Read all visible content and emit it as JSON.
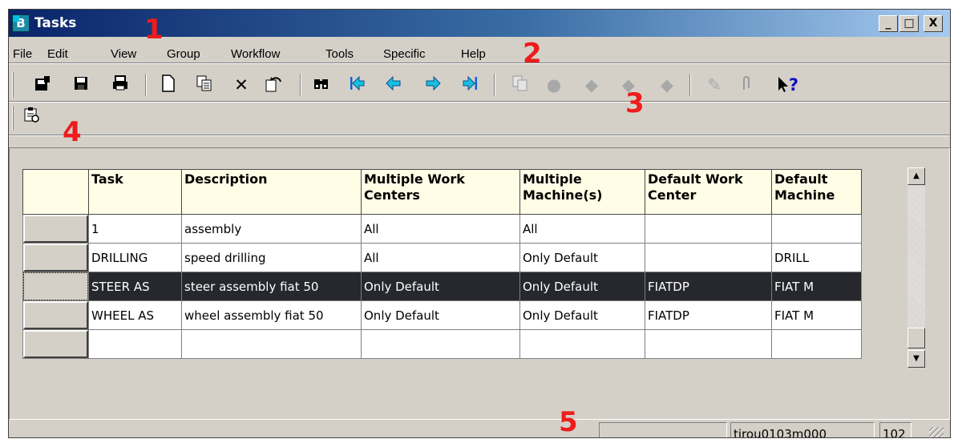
{
  "window": {
    "title": "Tasks",
    "minimize": "_",
    "maximize": "□",
    "close": "X"
  },
  "menu": [
    {
      "label": "File"
    },
    {
      "label": "Edit"
    },
    {
      "label": "View"
    },
    {
      "label": "Group"
    },
    {
      "label": "Workflow"
    },
    {
      "label": "Tools"
    },
    {
      "label": "Specific"
    },
    {
      "label": "Help"
    }
  ],
  "toolbar": {
    "icons": [
      "save-and-exit-icon",
      "save-icon",
      "print-icon",
      "new-icon",
      "duplicate-icon",
      "delete-icon",
      "undo-icon",
      "find-icon",
      "first-record-icon",
      "previous-record-icon",
      "next-record-icon",
      "last-record-icon",
      "copy-disabled-icon",
      "view-disabled-icon",
      "group-first-disabled-icon",
      "group-next-disabled-icon",
      "group-last-disabled-icon",
      "text-disabled-icon",
      "attachment-disabled-icon",
      "whats-this-help-icon"
    ],
    "help_label": "?"
  },
  "toolbar2": {
    "icons": [
      "specific-action-icon"
    ]
  },
  "grid": {
    "columns": [
      "Task",
      "Description",
      "Multiple Work Centers",
      "Multiple Machine(s)",
      "Default Work Center",
      "Default Machine"
    ],
    "rows": [
      [
        "1",
        "assembly",
        "All",
        "All",
        "",
        ""
      ],
      [
        "DRILLING",
        "speed drilling",
        "All",
        "Only Default",
        "",
        "DRILL"
      ],
      [
        "STEER AS",
        "steer assembly fiat 50",
        "Only Default",
        "Only Default",
        "FIATDP",
        "FIAT M"
      ],
      [
        "WHEEL AS",
        "wheel assembly fiat 50",
        "Only Default",
        "Only Default",
        "FIATDP",
        "FIAT M"
      ],
      [
        "",
        "",
        "",
        "",
        "",
        ""
      ]
    ],
    "selected_row": 2
  },
  "scrollbar": {
    "up": "▲",
    "down": "▼"
  },
  "status": {
    "panel1": "",
    "session": "tirou0103m000",
    "company": "102"
  },
  "annotations": {
    "a1": "1",
    "a2": "2",
    "a3": "3",
    "a4": "4",
    "a5": "5"
  },
  "colors": {
    "titlebar_start": "#0a246a",
    "titlebar_end": "#a6caf0",
    "header_bg": "#fffde6",
    "selected_row_bg": "#26282e",
    "annotation": "#ee1c1c"
  }
}
